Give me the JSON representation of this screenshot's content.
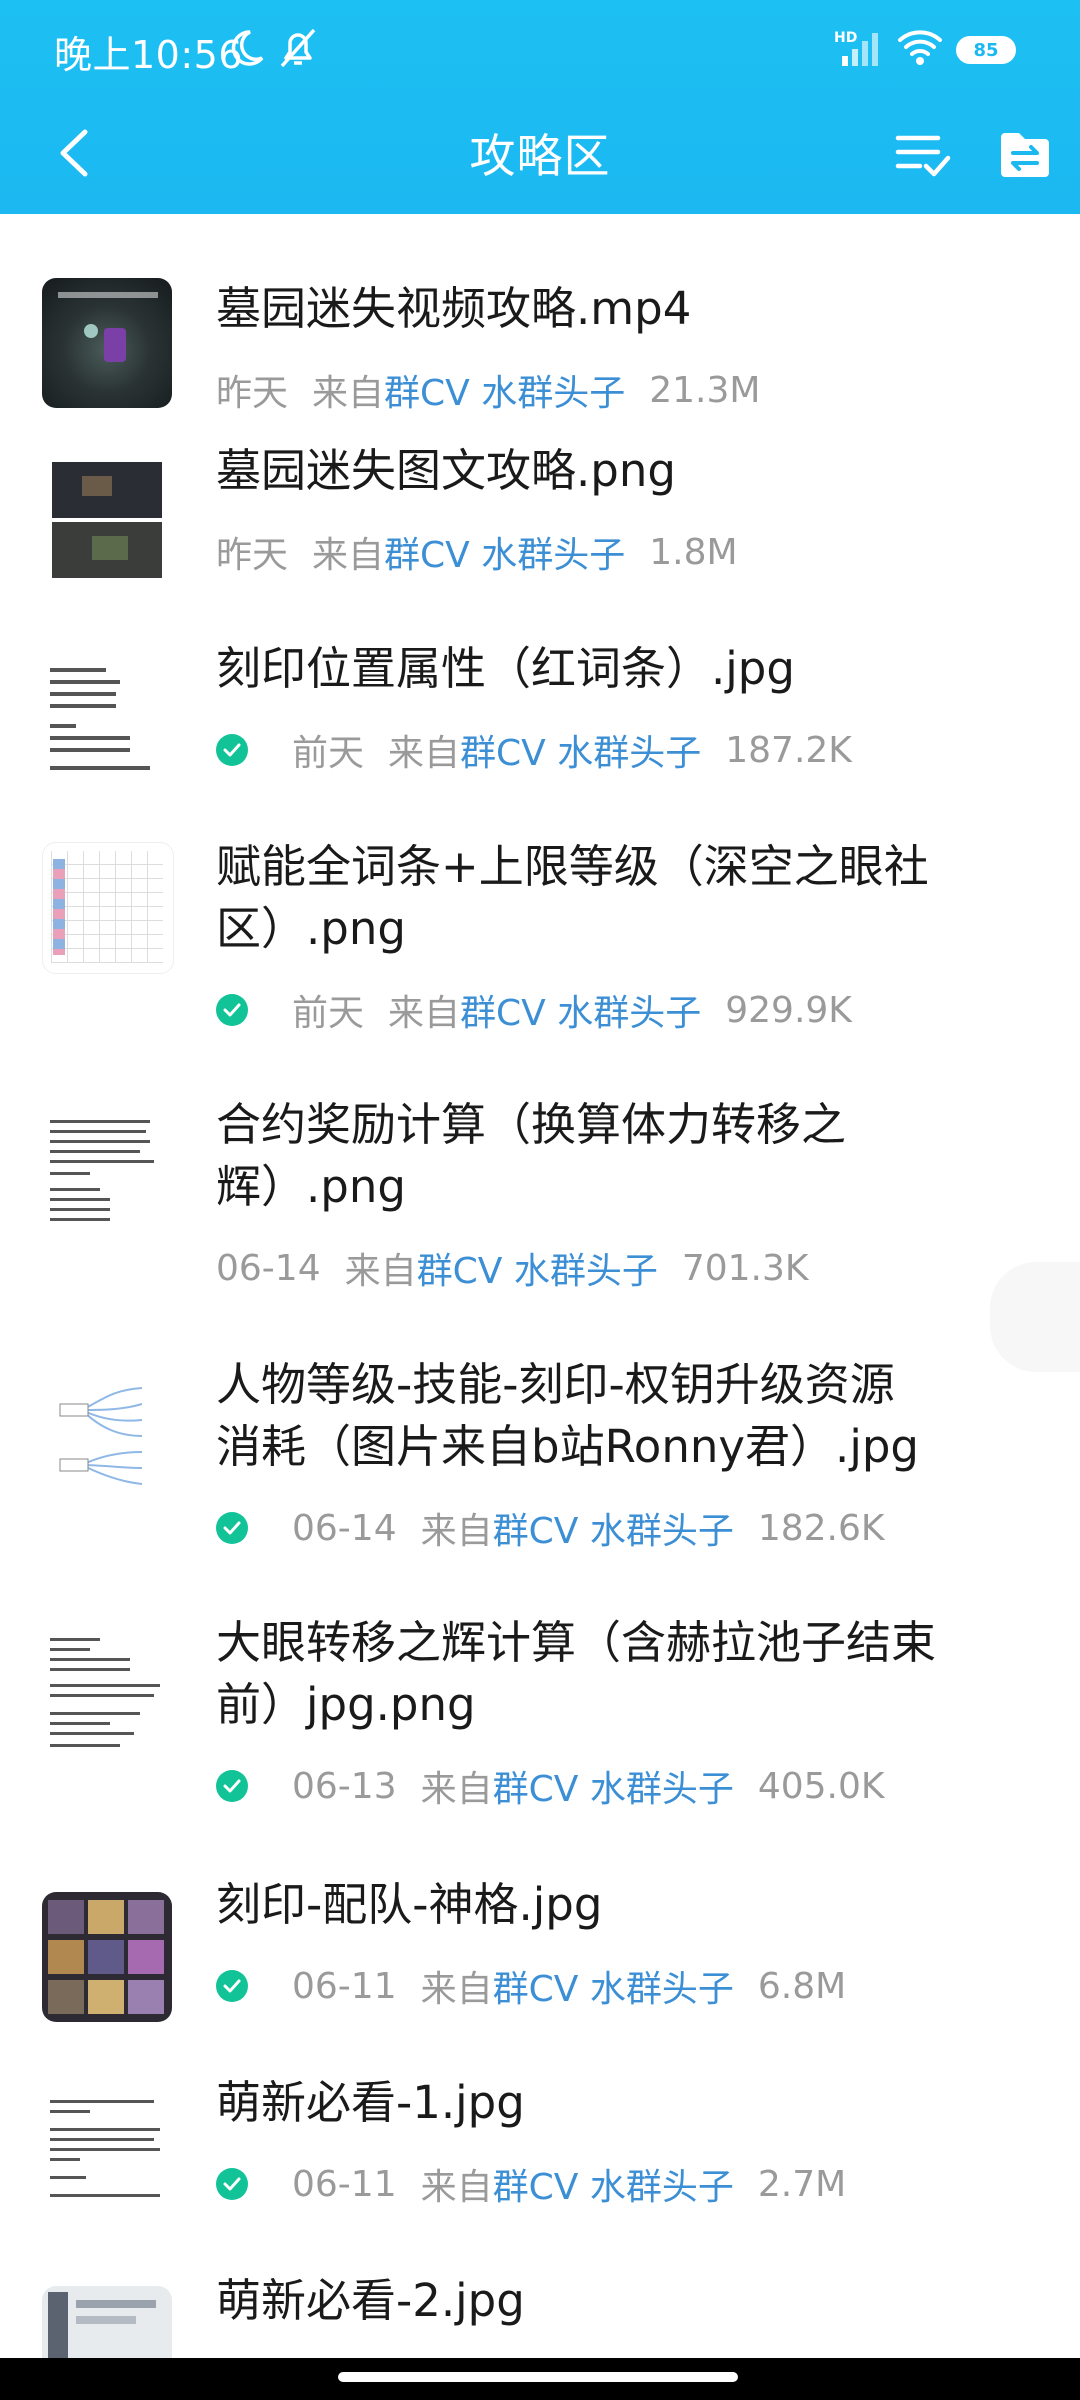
{
  "status_bar": {
    "time": "晚上10:56",
    "network_label": "HD",
    "battery": "85"
  },
  "header": {
    "title": "攻略区"
  },
  "colors": {
    "header": "#1cb9f1",
    "source_link": "#3c8fd4",
    "check_badge": "#13c398",
    "meta_text": "#9a9a9a"
  },
  "files": [
    {
      "name": "墓园迷失视频攻略.mp4",
      "date": "昨天",
      "from_label": "来自",
      "source": "群CV 水群头子",
      "size": "21.3M",
      "downloaded": false,
      "thumb": "video-dark"
    },
    {
      "name": "墓园迷失图文攻略.png",
      "date": "昨天",
      "from_label": "来自",
      "source": "群CV 水群头子",
      "size": "1.8M",
      "downloaded": false,
      "thumb": "map-screens"
    },
    {
      "name": "刻印位置属性（红词条）.jpg",
      "date": "前天",
      "from_label": "来自",
      "source": "群CV 水群头子",
      "size": "187.2K",
      "downloaded": true,
      "thumb": "text-doc"
    },
    {
      "name": "赋能全词条+上限等级（深空之眼社区）.png",
      "date": "前天",
      "from_label": "来自",
      "source": "群CV 水群头子",
      "size": "929.9K",
      "downloaded": true,
      "thumb": "table-doc"
    },
    {
      "name": "合约奖励计算（换算体力转移之辉）.png",
      "date": "06-14",
      "from_label": "来自",
      "source": "群CV 水群头子",
      "size": "701.3K",
      "downloaded": false,
      "thumb": "text-doc"
    },
    {
      "name": "人物等级-技能-刻印-权钥升级资源消耗（图片来自b站Ronny君）.jpg",
      "date": "06-14",
      "from_label": "来自",
      "source": "群CV 水群头子",
      "size": "182.6K",
      "downloaded": true,
      "thumb": "mindmap"
    },
    {
      "name": "大眼转移之辉计算（含赫拉池子结束前）jpg.png",
      "date": "06-13",
      "from_label": "来自",
      "source": "群CV 水群头子",
      "size": "405.0K",
      "downloaded": true,
      "thumb": "text-doc"
    },
    {
      "name": "刻印-配队-神格.jpg",
      "date": "06-11",
      "from_label": "来自",
      "source": "群CV 水群头子",
      "size": "6.8M",
      "downloaded": true,
      "thumb": "char-grid"
    },
    {
      "name": "萌新必看-1.jpg",
      "date": "06-11",
      "from_label": "来自",
      "source": "群CV 水群头子",
      "size": "2.7M",
      "downloaded": true,
      "thumb": "text-doc"
    },
    {
      "name": "萌新必看-2.jpg",
      "date": "",
      "from_label": "",
      "source": "",
      "size": "",
      "downloaded": false,
      "thumb": "ui-screen"
    }
  ]
}
